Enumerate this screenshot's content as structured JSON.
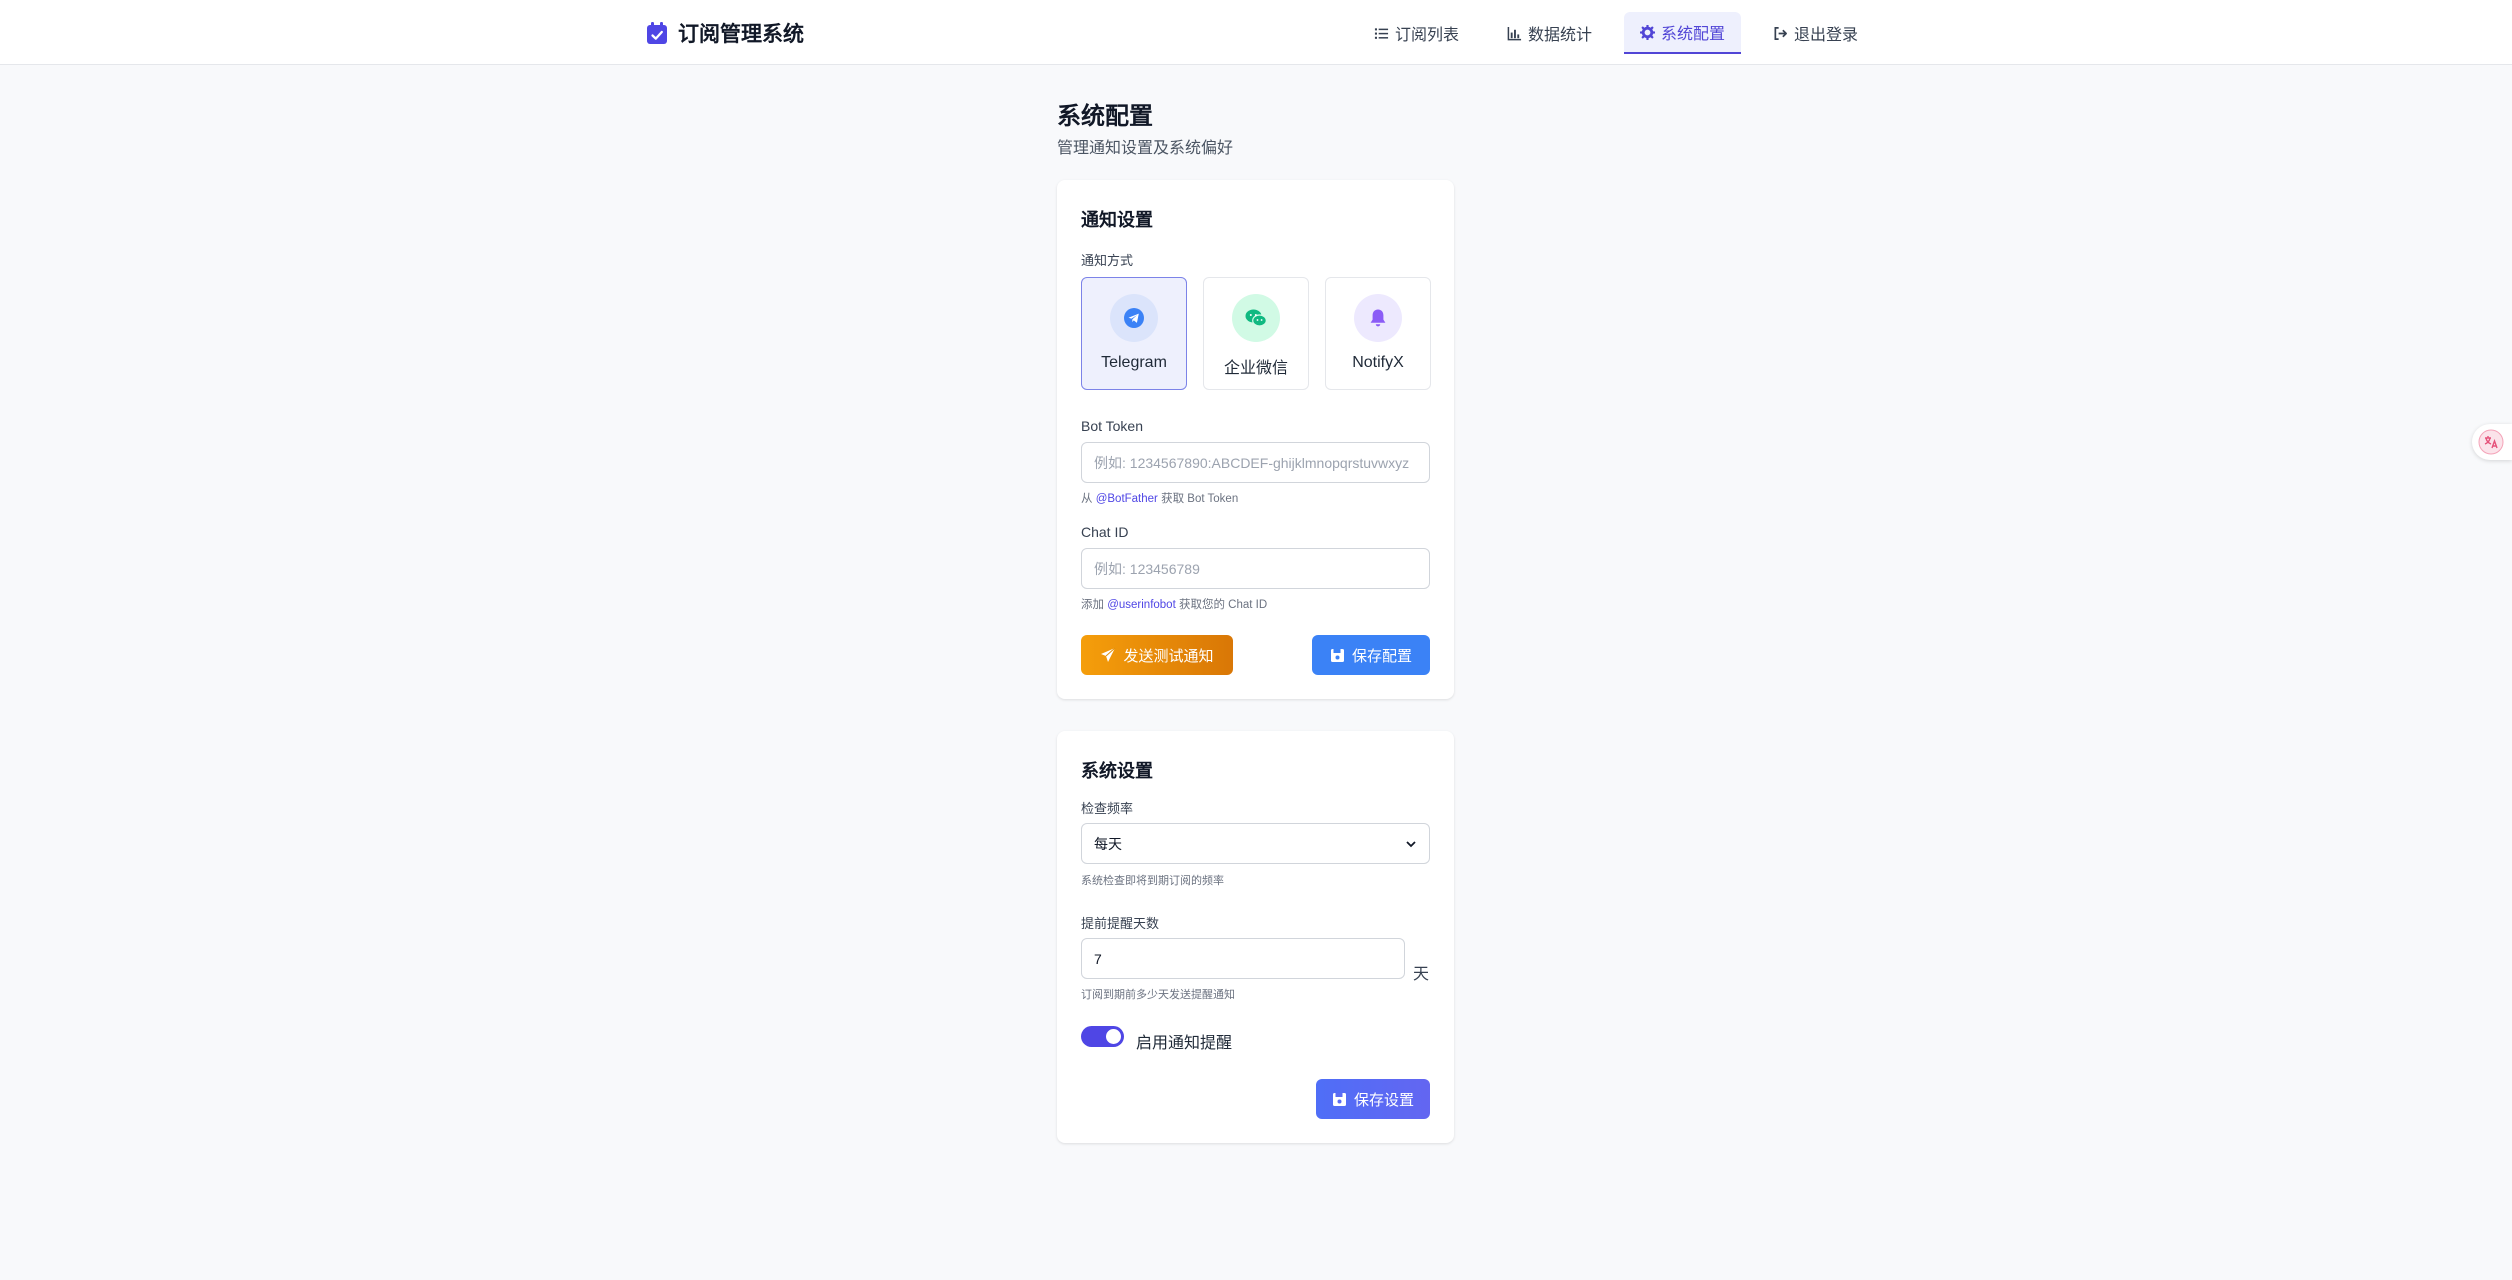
{
  "app": {
    "title": "订阅管理系统"
  },
  "nav": [
    {
      "label": "订阅列表",
      "icon": "list-icon",
      "active": false
    },
    {
      "label": "数据统计",
      "icon": "chart-icon",
      "active": false
    },
    {
      "label": "系统配置",
      "icon": "gear-icon",
      "active": true
    },
    {
      "label": "退出登录",
      "icon": "logout-icon",
      "active": false
    }
  ],
  "page": {
    "title": "系统配置",
    "subtitle": "管理通知设置及系统偏好"
  },
  "notify": {
    "title": "通知设置",
    "method_label": "通知方式",
    "channels": [
      {
        "label": "Telegram",
        "icon": "telegram-icon",
        "selected": true
      },
      {
        "label": "企业微信",
        "icon": "wechat-icon",
        "selected": false
      },
      {
        "label": "NotifyX",
        "icon": "bell-icon",
        "selected": false
      }
    ],
    "bot_token_label": "Bot Token",
    "bot_token_placeholder": "例如: 1234567890:ABCDEF-ghijklmnopqrstuvwxyz",
    "bot_token_hint_pre": "从",
    "bot_token_hint_link": "@BotFather",
    "bot_token_hint_post": "获取 Bot Token",
    "chat_id_label": "Chat ID",
    "chat_id_placeholder": "例如: 123456789",
    "chat_id_hint_pre": "添加",
    "chat_id_hint_link": "@userinfobot",
    "chat_id_hint_post": "获取您的 Chat ID",
    "test_button": "发送测试通知",
    "save_button": "保存配置"
  },
  "system": {
    "title": "系统设置",
    "frequency_label": "检查频率",
    "frequency_value": "每天",
    "frequency_hint": "系统检查即将到期订阅的频率",
    "days_label": "提前提醒天数",
    "days_value": "7",
    "days_unit": "天",
    "days_hint": "订阅到期前多少天发送提醒通知",
    "toggle_label": "启用通知提醒",
    "toggle_on": true,
    "save_button": "保存设置"
  },
  "colors": {
    "accent": "#5145d6",
    "orange": "#f59e0b",
    "blue": "#3b82f6",
    "background": "#f8f9fb"
  }
}
